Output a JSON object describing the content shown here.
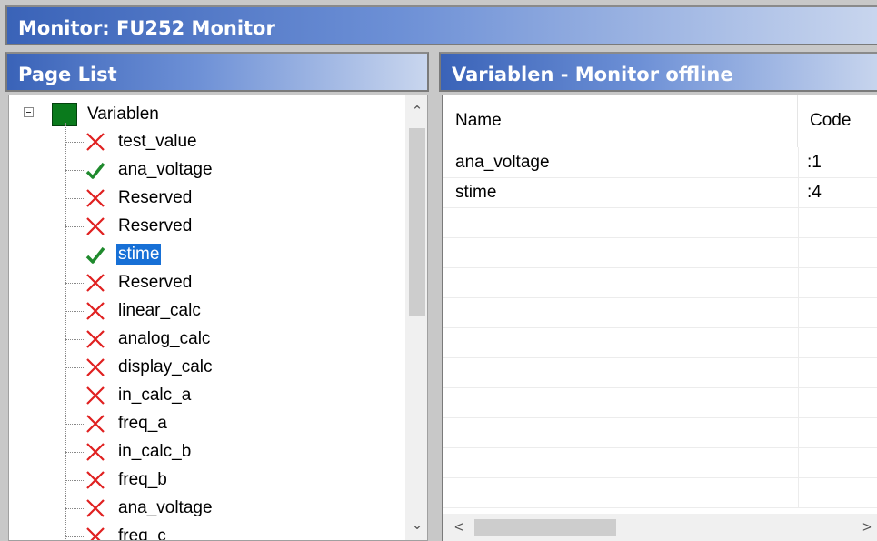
{
  "window": {
    "title": "Monitor: FU252 Monitor"
  },
  "page_list": {
    "title": "Page List",
    "root_label": "Variablen",
    "items": [
      {
        "label": "test_value",
        "status": "error"
      },
      {
        "label": "ana_voltage",
        "status": "ok"
      },
      {
        "label": "Reserved",
        "status": "error"
      },
      {
        "label": "Reserved",
        "status": "error"
      },
      {
        "label": "stime",
        "status": "ok",
        "selected": true
      },
      {
        "label": "Reserved",
        "status": "error"
      },
      {
        "label": "linear_calc",
        "status": "error"
      },
      {
        "label": "analog_calc",
        "status": "error"
      },
      {
        "label": "display_calc",
        "status": "error"
      },
      {
        "label": "in_calc_a",
        "status": "error"
      },
      {
        "label": "freq_a",
        "status": "error"
      },
      {
        "label": "in_calc_b",
        "status": "error"
      },
      {
        "label": "freq_b",
        "status": "error"
      },
      {
        "label": "ana_voltage",
        "status": "error"
      },
      {
        "label": "freq_c",
        "status": "error"
      }
    ]
  },
  "monitor": {
    "title": "Variablen - Monitor offline",
    "columns": {
      "name": "Name",
      "code": "Code"
    },
    "rows": [
      {
        "name": "ana_voltage",
        "code": ":1"
      },
      {
        "name": "stime",
        "code": ":4"
      }
    ]
  },
  "colors": {
    "ok": "#1f8a2d",
    "error": "#e02020",
    "selection": "#1770d6",
    "root_icon": "#0a7a1c"
  }
}
